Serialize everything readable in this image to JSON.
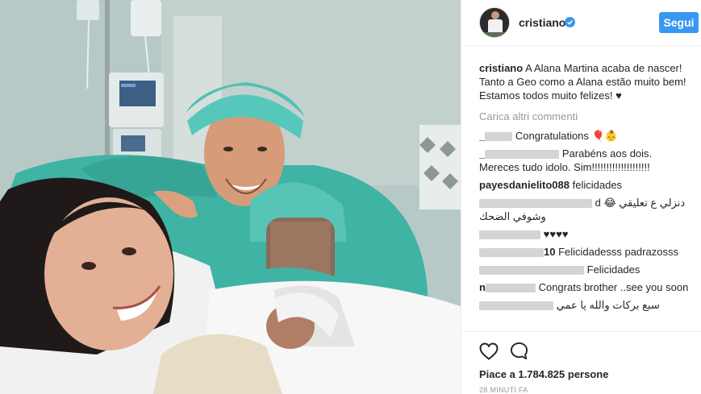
{
  "post": {
    "photo_alt": "hospital selfie photo"
  },
  "header": {
    "username": "cristiano",
    "follow_label": "Segui"
  },
  "caption": {
    "author": "cristiano",
    "text": "A Alana Martina acaba de nascer! Tanto a Geo como a Alana estão muito bem! Estamos todos muito felizes! ♥"
  },
  "load_more": "Carica altri commenti",
  "comments": [
    {
      "author": "_",
      "text": "Congratulations 🎈👶"
    },
    {
      "author": "_",
      "text": "Parabéns aos dois. Mereces tudo idolo. Sim!!!!!!!!!!!!!!!!!!!!"
    },
    {
      "author": "payesdanielito088",
      "text": "felicidades"
    },
    {
      "author": "",
      "text": "d 😂 دنزلي ع تعليقي وشوفي الضحك"
    },
    {
      "author": "",
      "text": "♥♥♥♥"
    },
    {
      "author": "10",
      "text": "Felicidadesss padrazosss"
    },
    {
      "author": "",
      "text": "Felicidades"
    },
    {
      "author": "n",
      "text": "Congrats brother ..see you soon"
    },
    {
      "author": "",
      "text": "سبع بركات والله يا عمي"
    }
  ],
  "actions": {
    "likes_text": "Piace a 1.784.825 persone",
    "timestamp": "28 MINUTI FA"
  },
  "colors": {
    "accent": "#3897f0",
    "muted": "#999999",
    "text": "#262626"
  },
  "icons": {
    "verified": "verified-badge-icon",
    "like": "heart-outline-icon",
    "comment": "speech-bubble-icon"
  }
}
